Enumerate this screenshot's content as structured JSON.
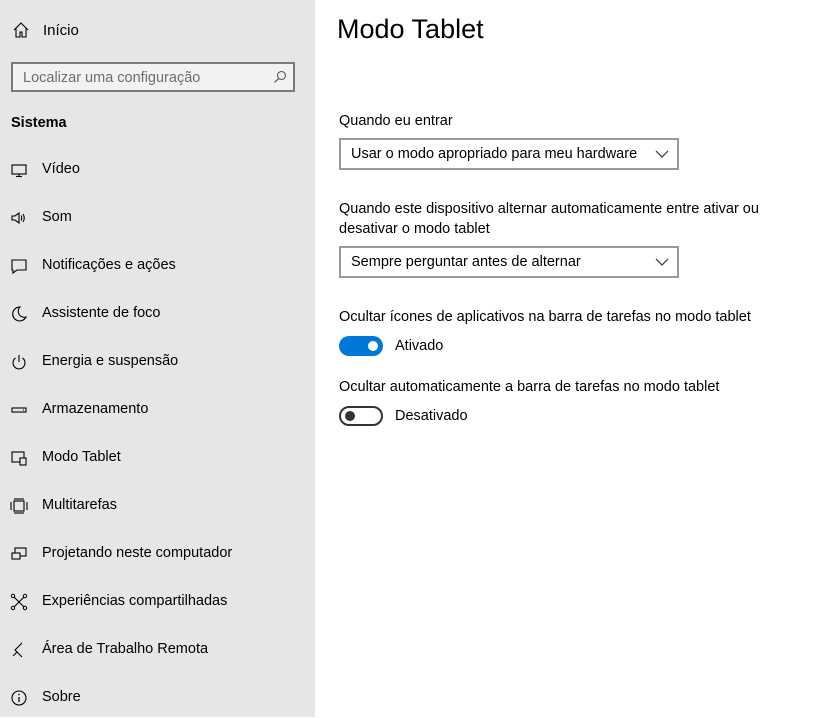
{
  "sidebar": {
    "home_label": "Início",
    "search_placeholder": "Localizar uma configuração",
    "section_title": "Sistema",
    "items": [
      {
        "label": "Vídeo",
        "icon": "monitor-icon"
      },
      {
        "label": "Som",
        "icon": "speaker-icon"
      },
      {
        "label": "Notificações e ações",
        "icon": "notification-icon"
      },
      {
        "label": "Assistente de foco",
        "icon": "moon-icon"
      },
      {
        "label": "Energia e suspensão",
        "icon": "power-icon"
      },
      {
        "label": "Armazenamento",
        "icon": "storage-icon"
      },
      {
        "label": "Modo Tablet",
        "icon": "tablet-mode-icon"
      },
      {
        "label": "Multitarefas",
        "icon": "multitasking-icon"
      },
      {
        "label": "Projetando neste computador",
        "icon": "projecting-icon"
      },
      {
        "label": "Experiências compartilhadas",
        "icon": "shared-experiences-icon"
      },
      {
        "label": "Área de Trabalho Remota",
        "icon": "remote-desktop-icon"
      },
      {
        "label": "Sobre",
        "icon": "info-icon"
      }
    ]
  },
  "main": {
    "title": "Modo Tablet",
    "signin_label": "Quando eu entrar",
    "signin_value": "Usar o modo apropriado para meu hardware",
    "switch_label": "Quando este dispositivo alternar automaticamente entre ativar ou desativar o modo tablet",
    "switch_value": "Sempre perguntar antes de alternar",
    "hide_icons_label": "Ocultar ícones de aplicativos na barra de tarefas no modo tablet",
    "hide_icons_state": "Ativado",
    "hide_icons_on": true,
    "autohide_label": "Ocultar automaticamente a barra de tarefas no modo tablet",
    "autohide_state": "Desativado",
    "autohide_on": false
  },
  "colors": {
    "accent": "#0078d7",
    "sidebar_bg": "#e6e6e6"
  }
}
